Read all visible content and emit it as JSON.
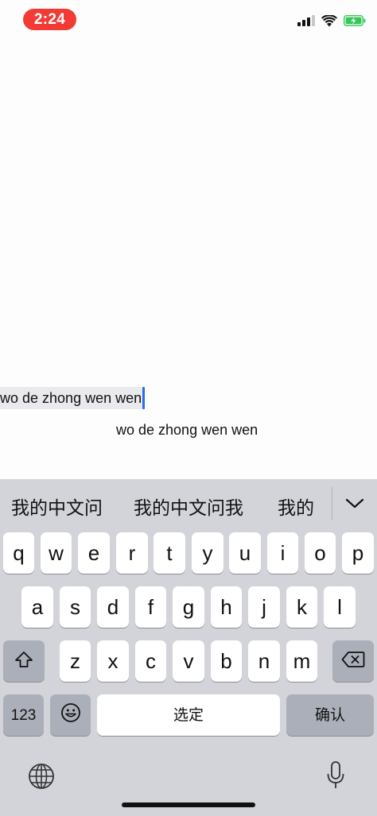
{
  "status_bar": {
    "time": "2:24",
    "icons": [
      "cellular-signal-icon",
      "wifi-icon",
      "battery-charging-icon"
    ],
    "pill_color": "#f23b35",
    "battery_color": "#34c759"
  },
  "editor": {
    "marked_text": "wo de zhong wen wen",
    "echo_text": "wo de zhong wen wen",
    "caret_color": "#2a6ee8"
  },
  "keyboard": {
    "candidates": [
      "我的中文问",
      "我的中文问我",
      "我的"
    ],
    "expand_icon": "chevron-down-icon",
    "row1": [
      "q",
      "w",
      "e",
      "r",
      "t",
      "y",
      "u",
      "i",
      "o",
      "p"
    ],
    "row2": [
      "a",
      "s",
      "d",
      "f",
      "g",
      "h",
      "j",
      "k",
      "l"
    ],
    "row3": [
      "z",
      "x",
      "c",
      "v",
      "b",
      "n",
      "m"
    ],
    "shift_icon": "shift-icon",
    "delete_icon": "delete-backspace-icon",
    "numbers_label": "123",
    "emoji_icon": "emoji-icon",
    "space_label": "选定",
    "return_label": "确认",
    "globe_icon": "globe-icon",
    "mic_icon": "microphone-icon"
  }
}
